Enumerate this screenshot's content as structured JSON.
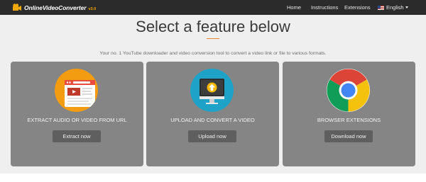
{
  "nav": {
    "logo_text": "OnlineVideoConverter",
    "logo_version": "v3.0",
    "home": "Home",
    "instructions": "Instructions",
    "extensions": "Extensions",
    "language": "English"
  },
  "hero": {
    "title": "Select a feature below",
    "subtitle": "Your no. 1 YouTube downloader and video conversion tool to convert a video link or file to various formats."
  },
  "cards": [
    {
      "label": "EXTRACT AUDIO OR VIDEO FROM URL",
      "button": "Extract now"
    },
    {
      "label": "UPLOAD AND CONVERT A VIDEO",
      "button": "Upload now"
    },
    {
      "label": "BROWSER EXTENSIONS",
      "button": "Download now"
    }
  ],
  "colors": {
    "navbar": "#2b2b2b",
    "card": "#858585",
    "button": "#5f5f5f",
    "accent": "#e58a2b"
  }
}
